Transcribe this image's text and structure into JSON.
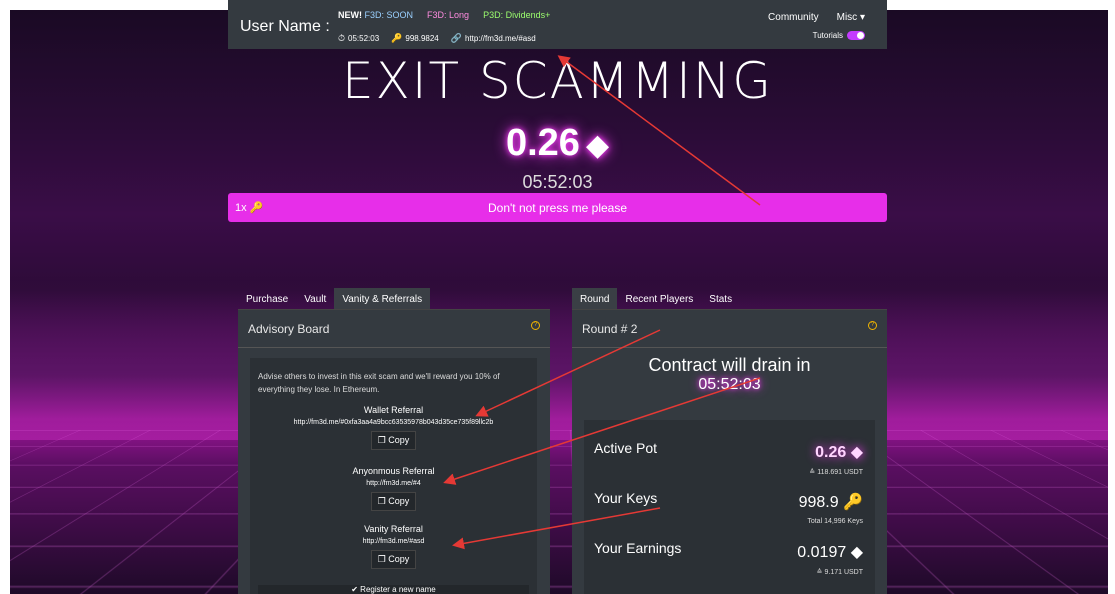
{
  "navbar": {
    "user": "User Name :",
    "new_badge": "NEW!",
    "link_soon": "F3D: SOON",
    "link_long": "F3D: Long",
    "link_p3d": "P3D: Dividends+",
    "timer": "05:52:03",
    "keys": "998.9824",
    "ref_link": "http://fm3d.me/#asd",
    "community": "Community",
    "misc": "Misc",
    "tutorials": "Tutorials"
  },
  "hero": {
    "title": "EXIT SCAMMING",
    "pot": "0.26",
    "timer": "05:52:03",
    "press_qty": "1x",
    "press_label": "Don't not press me please"
  },
  "left": {
    "tabs": [
      "Purchase",
      "Vault",
      "Vanity & Referrals"
    ],
    "heading": "Advisory Board",
    "advise": "Advise others to invest in this exit scam and we'll reward you 10% of everything they lose. In Ethereum.",
    "wallet_title": "Wallet Referral",
    "wallet_link": "http://fm3d.me/#0xfa3aa4a9bcc63535978b043d35ce735f89llc2b",
    "anon_title": "Anyonmous Referral",
    "anon_link": "http://fm3d.me/#4",
    "vanity_title": "Vanity Referral",
    "vanity_link": "http://fm3d.me/#asd",
    "copy": "Copy",
    "register": "✔ Register a new name"
  },
  "right": {
    "tabs": [
      "Round",
      "Recent Players",
      "Stats"
    ],
    "heading": "Round # 2",
    "drain_text": "Contract will drain in",
    "drain_time": "05:52:03",
    "active_pot_label": "Active Pot",
    "active_pot_value": "0.26",
    "active_pot_sub": "≙ 118.691 USDT",
    "keys_label": "Your Keys",
    "keys_value": "998.9",
    "keys_sub": "Total 14,996 Keys",
    "earn_label": "Your Earnings",
    "earn_value": "0.0197",
    "earn_sub": "≙ 9.171 USDT"
  },
  "colors": {
    "accent": "#e72ee9",
    "panel": "#343a40",
    "annotation": "#e53935"
  }
}
